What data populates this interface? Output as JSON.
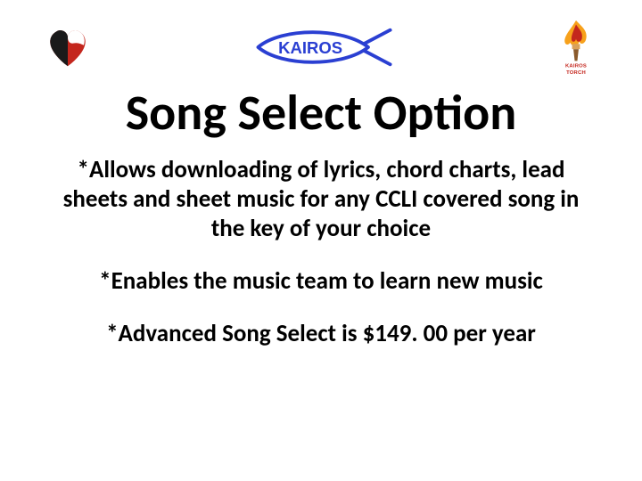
{
  "logos": {
    "left_name": "heart-face-logo",
    "center_name": "kairos-fish-logo",
    "center_text": "KAIROS",
    "right_name": "kairos-torch-logo",
    "right_caption_top": "KAIROS",
    "right_caption_bottom": "TORCH"
  },
  "title": "Song Select Option",
  "bullets": [
    "*Allows downloading of lyrics, chord charts, lead sheets and sheet music for any CCLI covered song in the key of your choice",
    "*Enables the music team to learn new music",
    "*Advanced Song Select is $149. 00 per year"
  ]
}
